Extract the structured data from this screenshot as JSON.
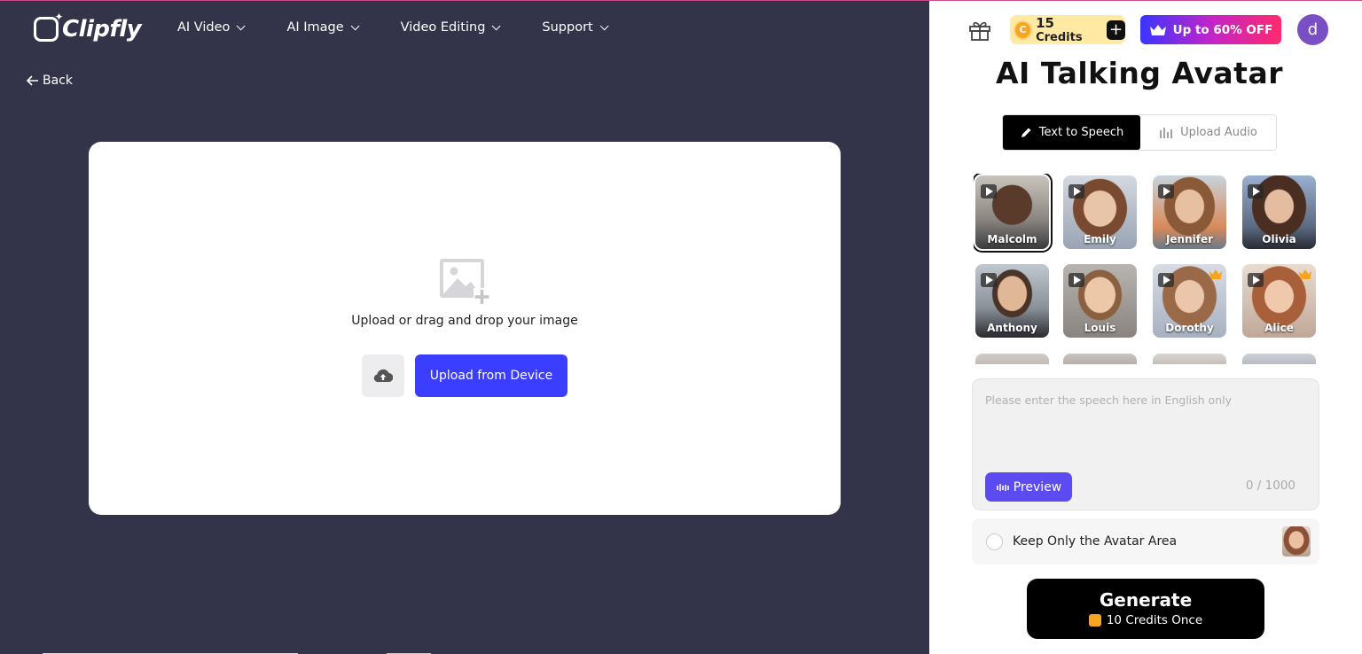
{
  "app": {
    "logo_text": "Clipfly"
  },
  "nav": {
    "items": [
      {
        "label": "AI Video"
      },
      {
        "label": "AI Image"
      },
      {
        "label": "Video Editing"
      },
      {
        "label": "Support"
      }
    ],
    "back_label": "Back"
  },
  "upload": {
    "prompt": "Upload or drag and drop your image",
    "device_button": "Upload from Device"
  },
  "header": {
    "credits_count": "15",
    "credits_word": "Credits",
    "upgrade_label": "Up to 60% OFF",
    "avatar_letter": "d"
  },
  "panel": {
    "title": "AI Talking Avatar",
    "tabs": [
      {
        "label": "Text to Speech",
        "active": true
      },
      {
        "label": "Upload Audio",
        "active": false
      }
    ],
    "avatars": [
      {
        "name": "Malcolm",
        "selected": true,
        "premium": false
      },
      {
        "name": "Emily",
        "selected": false,
        "premium": false
      },
      {
        "name": "Jennifer",
        "selected": false,
        "premium": false
      },
      {
        "name": "Olivia",
        "selected": false,
        "premium": false
      },
      {
        "name": "Anthony",
        "selected": false,
        "premium": false
      },
      {
        "name": "Louis",
        "selected": false,
        "premium": false
      },
      {
        "name": "Dorothy",
        "selected": false,
        "premium": true
      },
      {
        "name": "Alice",
        "selected": false,
        "premium": true
      }
    ],
    "speech_placeholder": "Please enter the speech here in English only",
    "preview_label": "Preview",
    "counter": "0 / 1000",
    "keep_label": "Keep Only the Avatar Area",
    "generate_label": "Generate",
    "generate_cost": "10 Credits Once"
  },
  "colors": {
    "bg_dark": "#33334a",
    "accent_blue": "#3b3dff",
    "preview_purple": "#5b4bf0",
    "credits_bg": "#ffe9a3"
  }
}
